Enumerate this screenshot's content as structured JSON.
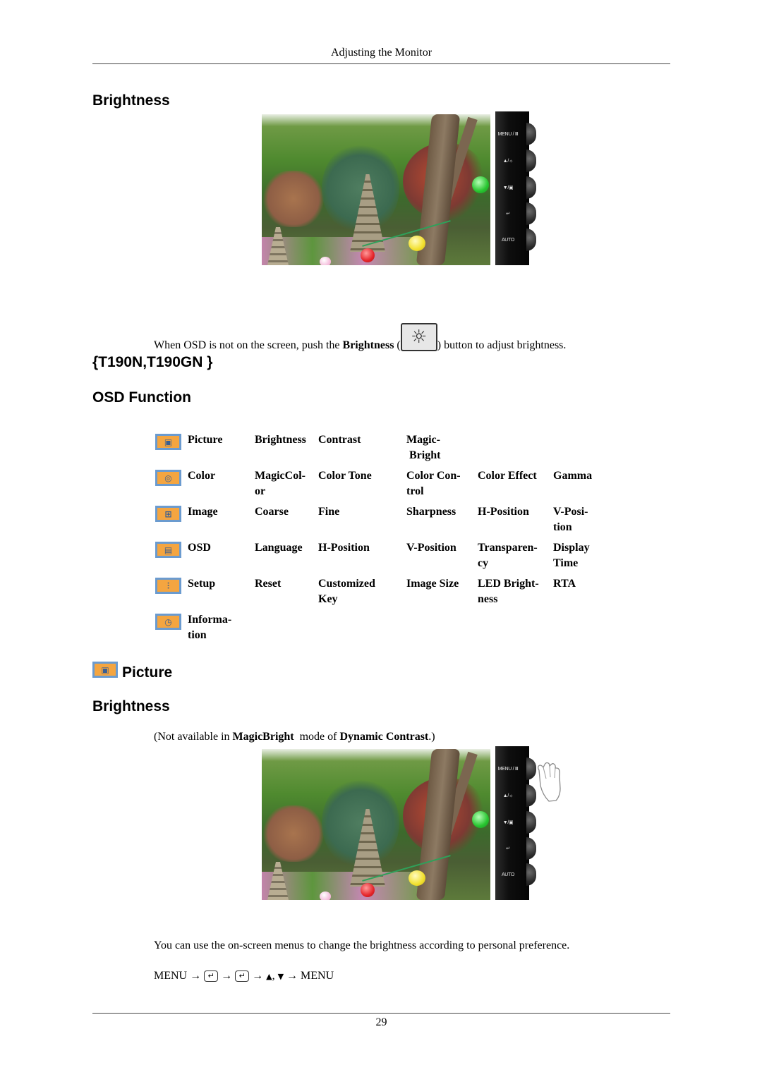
{
  "header": {
    "running_title": "Adjusting the Monitor"
  },
  "section1": {
    "title": "Brightness",
    "monitor_buttons": [
      {
        "label": "MENU / Ⅲ",
        "icon": "menu-icon"
      },
      {
        "label": "▲/☼",
        "icon": "up-brightness-icon"
      },
      {
        "label": "▼/▣",
        "icon": "down-source-icon"
      },
      {
        "label": "↵",
        "icon": "enter-icon"
      },
      {
        "label": "AUTO",
        "icon": "auto-icon"
      }
    ],
    "instruction": {
      "before": "When OSD is not on the screen, push the ",
      "bold": "Brightness",
      "open_paren": " (",
      "icon_glyph": "☼",
      "after": ") button to adjust brightness."
    }
  },
  "models_heading": "{T190N,T190GN }",
  "osd_heading": "OSD Function",
  "osd_table": {
    "rows": [
      {
        "icon": "picture-icon",
        "glyph": "▣",
        "name": "Picture",
        "items": [
          "Brightness",
          "Contrast",
          "Magic- Bright",
          "",
          ""
        ]
      },
      {
        "icon": "color-icon",
        "glyph": "◎",
        "name": "Color",
        "items": [
          "MagicCol- or",
          "Color Tone",
          "Color Con- trol",
          "Color Effect",
          "Gamma"
        ]
      },
      {
        "icon": "image-icon",
        "glyph": "⊞",
        "name": "Image",
        "items": [
          "Coarse",
          "Fine",
          "Sharpness",
          "H-Position",
          "V-Posi- tion"
        ]
      },
      {
        "icon": "osd-icon",
        "glyph": "▤",
        "name": "OSD",
        "items": [
          "Language",
          "H-Position",
          "V-Position",
          "Transparen- cy",
          "Display Time"
        ]
      },
      {
        "icon": "setup-icon",
        "glyph": "⫶",
        "name": "Setup",
        "items": [
          "Reset",
          "Customized Key",
          "Image Size",
          "LED Bright- ness",
          "RTA"
        ]
      },
      {
        "icon": "information-icon",
        "glyph": "◷",
        "name": "Informa- tion",
        "items": [
          "",
          "",
          "",
          "",
          ""
        ]
      }
    ]
  },
  "section2": {
    "title": "Picture",
    "subtitle": "Brightness",
    "note": {
      "open": "(Not available in ",
      "bold1": "MagicBright",
      "mid": "  mode of ",
      "bold2": "Dynamic Contrast",
      "close": ".)"
    },
    "monitor_buttons": [
      {
        "label": "MENU / Ⅲ"
      },
      {
        "label": "▲/☼"
      },
      {
        "label": "▼/▣"
      },
      {
        "label": "↵"
      },
      {
        "label": "AUTO"
      }
    ],
    "description": "You can use the on-screen menus to change the brightness according to personal preference.",
    "sequence": {
      "menu1": "MENU",
      "arrow": "→",
      "enter": "↵",
      "up": "▲",
      "comma": ",",
      "down": "▼",
      "menu2": "MENU"
    }
  },
  "footer": {
    "page_number": "29"
  }
}
